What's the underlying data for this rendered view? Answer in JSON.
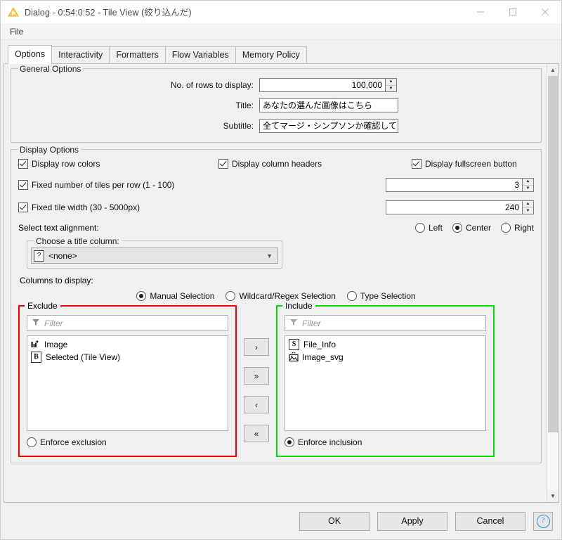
{
  "window": {
    "title": "Dialog - 0:54:0:52 - Tile View (絞り込んだ)",
    "app_icon": "knime-triangle-icon",
    "controls": {
      "minimize": "–",
      "maximize": "□",
      "close": "✕"
    }
  },
  "menubar": {
    "items": [
      {
        "label": "File"
      }
    ]
  },
  "tabs": [
    {
      "label": "Options",
      "active": true
    },
    {
      "label": "Interactivity",
      "active": false
    },
    {
      "label": "Formatters",
      "active": false
    },
    {
      "label": "Flow Variables",
      "active": false
    },
    {
      "label": "Memory Policy",
      "active": false
    }
  ],
  "general_options": {
    "legend": "General Options",
    "rows_label": "No. of rows to display:",
    "rows_value": "100,000",
    "title_label": "Title:",
    "title_value": "あなたの選んだ画像はこちら",
    "subtitle_label": "Subtitle:",
    "subtitle_value": "全てマージ・シンプソンか確認してください"
  },
  "display_options": {
    "legend": "Display Options",
    "display_row_colors": {
      "label": "Display row colors",
      "checked": true
    },
    "display_column_headers": {
      "label": "Display column headers",
      "checked": true
    },
    "display_fullscreen_button": {
      "label": "Display fullscreen button",
      "checked": true
    },
    "fixed_tiles_per_row": {
      "label": "Fixed number of tiles per row (1 - 100)",
      "checked": true,
      "value": "3"
    },
    "fixed_tile_width": {
      "label": "Fixed tile width (30 - 5000px)",
      "checked": true,
      "value": "240"
    },
    "text_alignment_label": "Select text alignment:",
    "text_alignment_options": [
      {
        "label": "Left",
        "selected": false
      },
      {
        "label": "Center",
        "selected": true
      },
      {
        "label": "Right",
        "selected": false
      }
    ],
    "title_column": {
      "legend": "Choose a title column:",
      "icon": "question-box-icon",
      "value": "<none>",
      "caret": "chevron-down-icon"
    },
    "columns_to_display_label": "Columns to display:"
  },
  "selection_mode": [
    {
      "label": "Manual Selection",
      "selected": true
    },
    {
      "label": "Wildcard/Regex Selection",
      "selected": false
    },
    {
      "label": "Type Selection",
      "selected": false
    }
  ],
  "exclude_pane": {
    "legend": "Exclude",
    "border_color": "#ff0000",
    "filter_placeholder": "Filter",
    "items": [
      {
        "label": "Image",
        "icon": "image-column-icon"
      },
      {
        "label": "Selected (Tile View)",
        "icon": "boolean-column-icon",
        "icon_letter": "B"
      }
    ],
    "enforce": {
      "label": "Enforce exclusion",
      "selected": false
    }
  },
  "include_pane": {
    "legend": "Include",
    "border_color": "#00e000",
    "filter_placeholder": "Filter",
    "items": [
      {
        "label": "File_Info",
        "icon": "string-column-icon",
        "icon_letter": "S"
      },
      {
        "label": "Image_svg",
        "icon": "svg-image-column-icon"
      }
    ],
    "enforce": {
      "label": "Enforce inclusion",
      "selected": true
    }
  },
  "transfer_buttons": [
    {
      "label": "›",
      "name": "add-selected-button"
    },
    {
      "label": "»",
      "name": "add-all-button"
    },
    {
      "label": "‹",
      "name": "remove-selected-button"
    },
    {
      "label": "«",
      "name": "remove-all-button"
    }
  ],
  "footer": {
    "ok": "OK",
    "apply": "Apply",
    "cancel": "Cancel",
    "help": "?"
  }
}
